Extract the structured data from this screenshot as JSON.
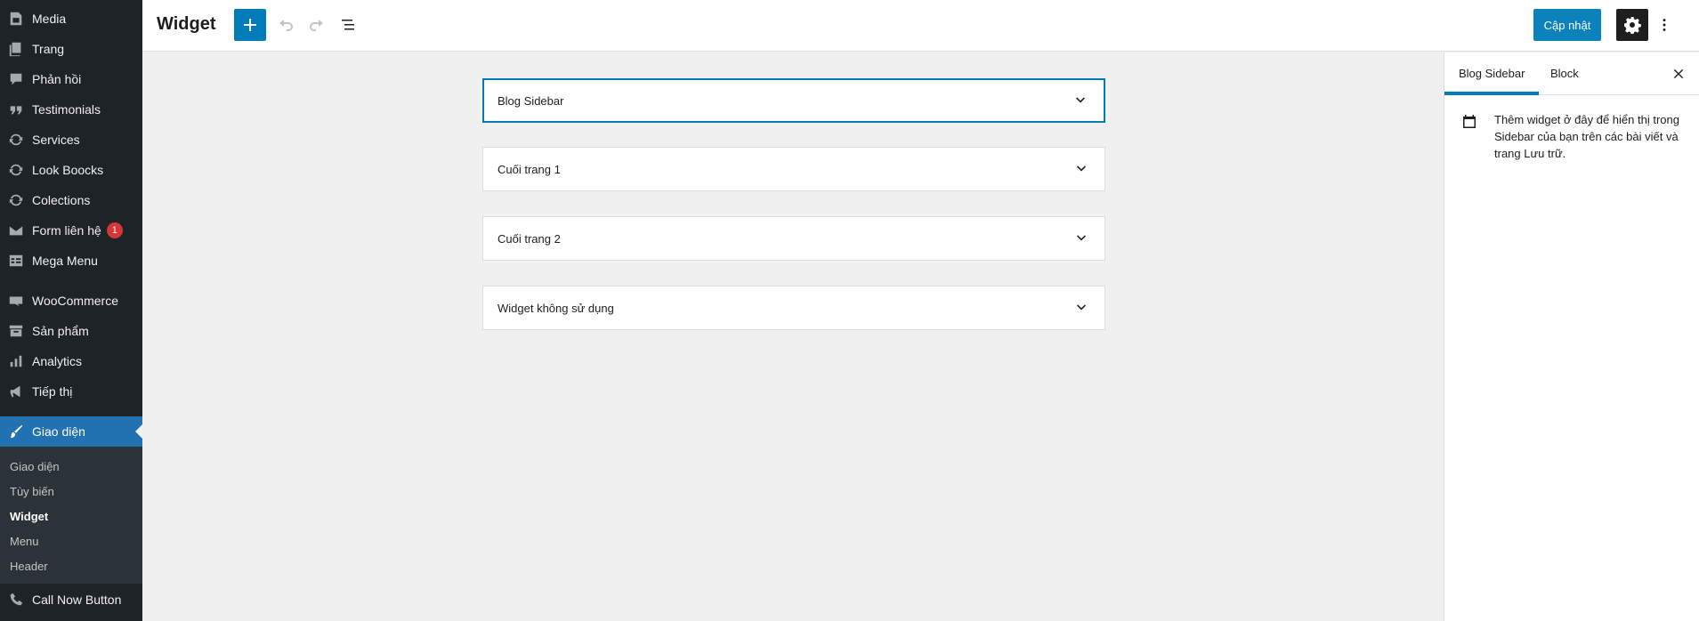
{
  "admin_menu": {
    "items": [
      {
        "label": "Media",
        "icon": "media-icon"
      },
      {
        "label": "Trang",
        "icon": "pages-icon"
      },
      {
        "label": "Phản hồi",
        "icon": "comments-icon"
      },
      {
        "label": "Testimonials",
        "icon": "quote-icon"
      },
      {
        "label": "Services",
        "icon": "cycle-icon"
      },
      {
        "label": "Look Boocks",
        "icon": "cycle-icon"
      },
      {
        "label": "Colections",
        "icon": "cycle-icon"
      },
      {
        "label": "Form liên hệ",
        "icon": "email-icon",
        "badge": "1"
      },
      {
        "label": "Mega Menu",
        "icon": "table-icon"
      },
      {
        "label": "WooCommerce",
        "icon": "woo-icon"
      },
      {
        "label": "Sản phẩm",
        "icon": "archive-icon"
      },
      {
        "label": "Analytics",
        "icon": "chart-bar-icon"
      },
      {
        "label": "Tiếp thị",
        "icon": "megaphone-icon"
      },
      {
        "label": "Giao diện",
        "icon": "brush-icon",
        "active": true
      },
      {
        "label": "Call Now Button",
        "icon": "phone-icon"
      }
    ],
    "submenu": [
      {
        "label": "Giao diện"
      },
      {
        "label": "Tùy biến"
      },
      {
        "label": "Widget",
        "current": true
      },
      {
        "label": "Menu"
      },
      {
        "label": "Header"
      }
    ]
  },
  "header": {
    "title": "Widget",
    "update_label": "Cập nhật"
  },
  "widget_areas": [
    {
      "label": "Blog Sidebar",
      "selected": true
    },
    {
      "label": "Cuối trang 1"
    },
    {
      "label": "Cuối trang 2"
    },
    {
      "label": "Widget không sử dụng"
    }
  ],
  "settings_panel": {
    "tabs": [
      {
        "label": "Blog Sidebar",
        "active": true
      },
      {
        "label": "Block"
      }
    ],
    "description": "Thêm widget ở đây để hiển thị trong Sidebar của bạn trên các bài viết và trang Lưu trữ."
  },
  "colors": {
    "admin_bg": "#1d2327",
    "admin_active": "#2271b1",
    "accent": "#007cba",
    "badge": "#d63638"
  }
}
